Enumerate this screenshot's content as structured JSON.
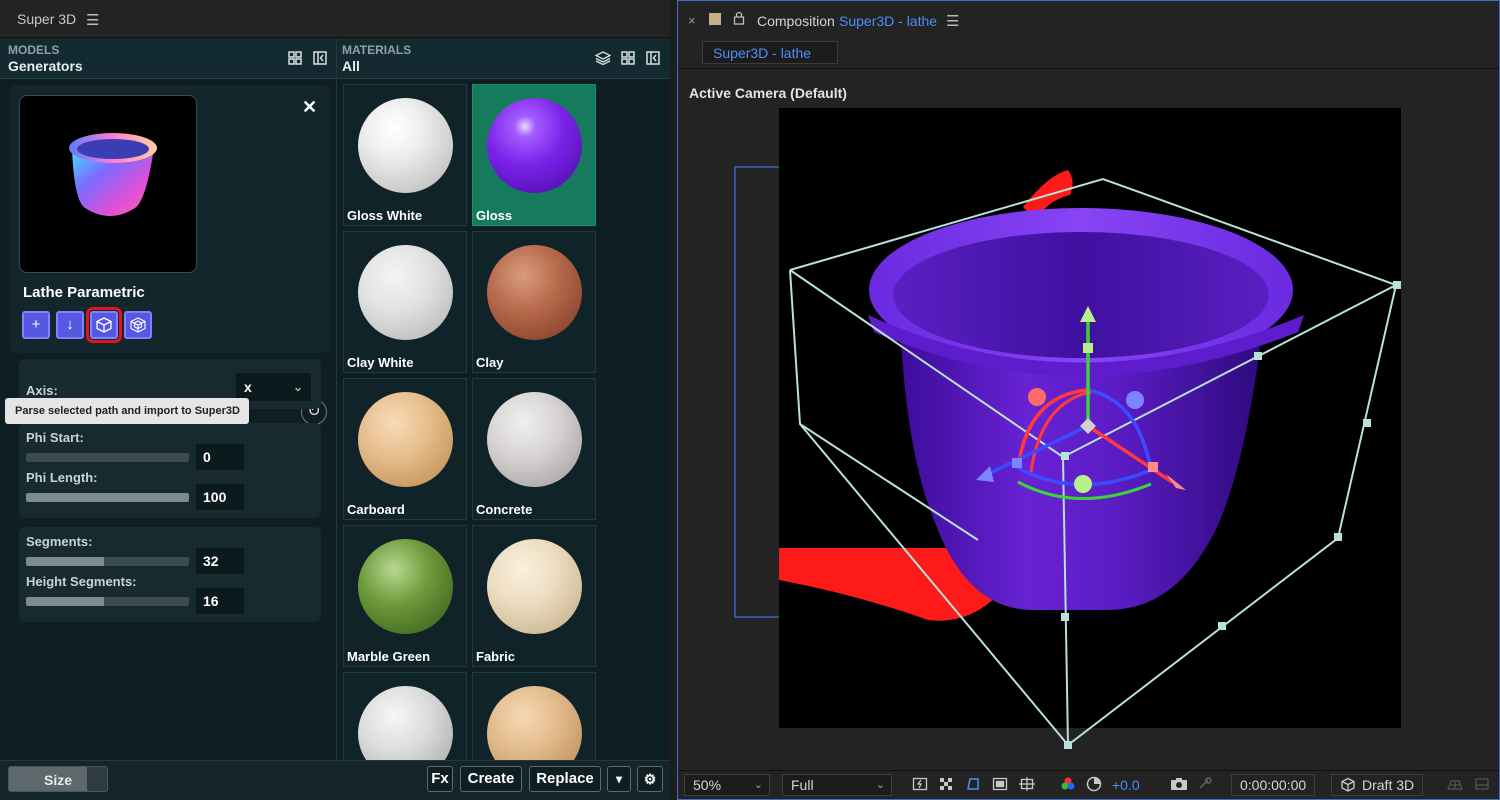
{
  "left_panel": {
    "tab_title": "Super 3D",
    "models": {
      "category": "MODELS",
      "subcategory": "Generators",
      "generator": {
        "title": "Lathe Parametric",
        "tooltip": "Parse selected path and import to Super3D"
      },
      "params": {
        "axis_label": "Axis:",
        "axis_value": "x",
        "phi_start_label": "Phi Start:",
        "phi_start_value": "0",
        "phi_length_label": "Phi Length:",
        "phi_length_value": "100",
        "segments_label": "Segments:",
        "segments_value": "32",
        "height_segments_label": "Height Segments:",
        "height_segments_value": "16"
      }
    },
    "materials": {
      "category": "MATERIALS",
      "subcategory": "All",
      "items": [
        {
          "label": "Gloss White"
        },
        {
          "label": "Gloss"
        },
        {
          "label": "Clay White"
        },
        {
          "label": "Clay"
        },
        {
          "label": "Carboard"
        },
        {
          "label": "Concrete"
        },
        {
          "label": "Marble Green"
        },
        {
          "label": "Fabric"
        },
        {
          "label": ""
        },
        {
          "label": ""
        }
      ],
      "selected": "Gloss"
    },
    "bottom": {
      "size_label": "Size",
      "fx_label": "Fx",
      "create_label": "Create",
      "replace_label": "Replace",
      "dropdown_glyph": "▾",
      "settings_glyph": "⚙"
    }
  },
  "composition": {
    "close_glyph": "×",
    "label": "Composition",
    "name": "Super3D - lathe",
    "subtab": "Super3D - lathe",
    "viewer_label": "Active Camera (Default)",
    "toolbar": {
      "zoom": "50%",
      "resolution": "Full",
      "exposure": "+0.0",
      "timecode": "0:00:00:00",
      "renderer": "Draft 3D"
    }
  },
  "colors": {
    "accent_blue": "#4c8ef5",
    "selected_material": "#167a5c",
    "generator_button": "#5558e0",
    "highlight_red": "#e0151b",
    "model_purple": "#6a1fd0"
  },
  "icons": [
    "menu-icon",
    "grid-icon",
    "collapse-icon",
    "layers-icon",
    "close-icon",
    "plus-icon",
    "download-icon",
    "cube-icon",
    "wireframe-cube-icon",
    "refresh-icon",
    "chevron-down-icon",
    "gear-icon",
    "lock-icon",
    "snapshot-icon",
    "color-channel-icon"
  ]
}
